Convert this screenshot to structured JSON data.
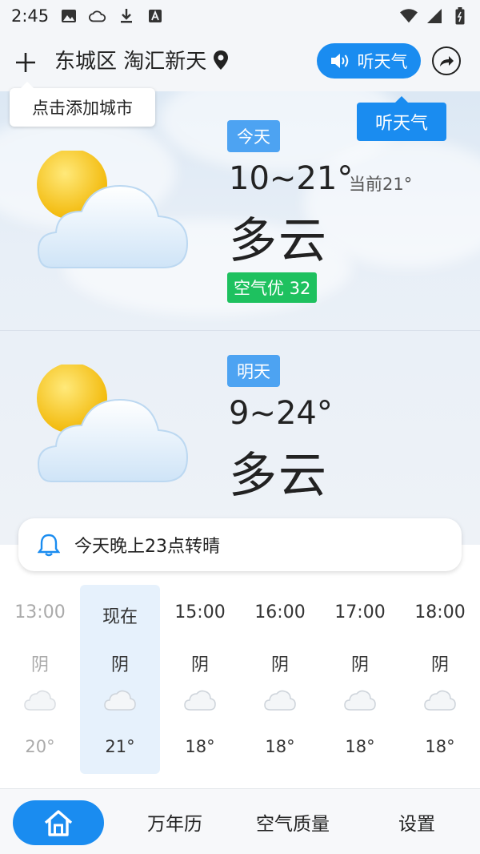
{
  "status_bar": {
    "time": "2:45"
  },
  "header": {
    "location": "东城区 淘汇新天",
    "listen_label": "听天气"
  },
  "tooltips": {
    "add_city": "点击添加城市",
    "listen": "听天气"
  },
  "today": {
    "tag": "今天",
    "temp_range": "10~21°",
    "current": "当前21°",
    "condition": "多云",
    "aqi": "空气优 32"
  },
  "tomorrow": {
    "tag": "明天",
    "temp_range": "9~24°",
    "condition": "多云"
  },
  "alert": {
    "text": "今天晚上23点转晴"
  },
  "hourly": [
    {
      "time": "13:00",
      "cond": "阴",
      "temp": "20°"
    },
    {
      "time": "现在",
      "cond": "阴",
      "temp": "21°"
    },
    {
      "time": "15:00",
      "cond": "阴",
      "temp": "18°"
    },
    {
      "time": "16:00",
      "cond": "阴",
      "temp": "18°"
    },
    {
      "time": "17:00",
      "cond": "阴",
      "temp": "18°"
    },
    {
      "time": "18:00",
      "cond": "阴",
      "temp": "18°"
    }
  ],
  "nav": {
    "calendar": "万年历",
    "air": "空气质量",
    "settings": "设置"
  },
  "colors": {
    "accent": "#1a8cf0",
    "tag_blue": "#4da3f2",
    "aqi_green": "#1ec15f"
  }
}
